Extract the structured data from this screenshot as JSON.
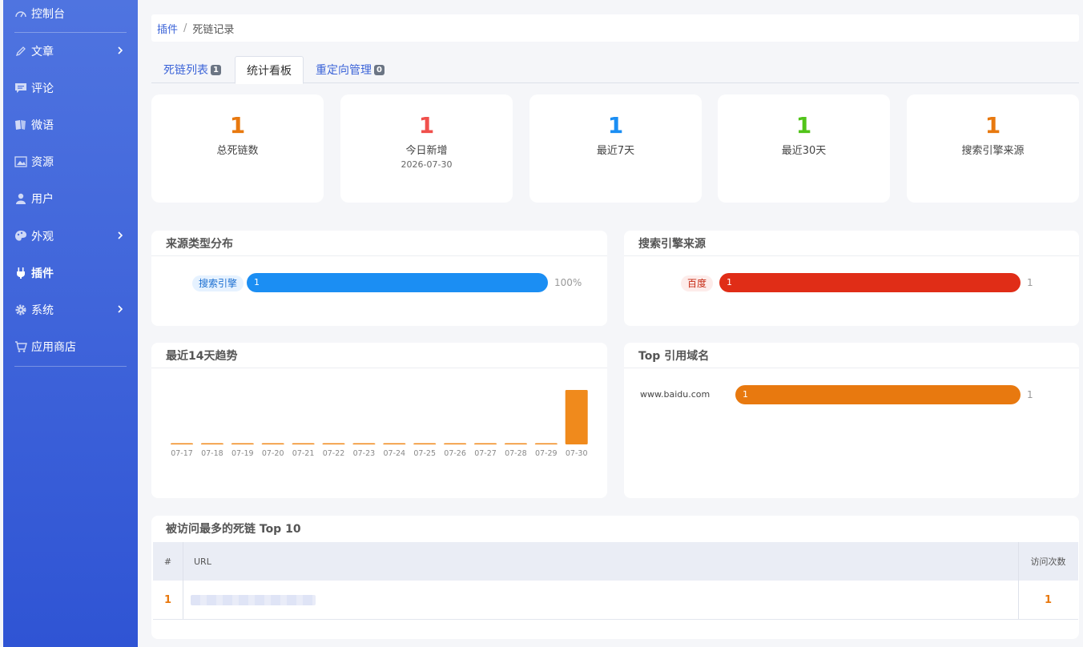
{
  "sidebar": {
    "items": [
      {
        "label": "控制台",
        "icon": "dashboard-icon",
        "has_children": false
      },
      {
        "label": "文章",
        "icon": "pencil-icon",
        "has_children": true
      },
      {
        "label": "评论",
        "icon": "comment-icon",
        "has_children": false
      },
      {
        "label": "微语",
        "icon": "cards-icon",
        "has_children": false
      },
      {
        "label": "资源",
        "icon": "image-icon",
        "has_children": false
      },
      {
        "label": "用户",
        "icon": "user-icon",
        "has_children": false
      },
      {
        "label": "外观",
        "icon": "palette-icon",
        "has_children": true
      },
      {
        "label": "插件",
        "icon": "plug-icon",
        "has_children": false,
        "active": true
      },
      {
        "label": "系统",
        "icon": "gear-icon",
        "has_children": true
      },
      {
        "label": "应用商店",
        "icon": "cart-icon",
        "has_children": false
      }
    ]
  },
  "breadcrumb": {
    "parent": "插件",
    "separator": "/",
    "current": "死链记录"
  },
  "tabs": [
    {
      "label": "死链列表",
      "count": "1"
    },
    {
      "label": "统计看板",
      "active": true
    },
    {
      "label": "重定向管理",
      "count": "0"
    }
  ],
  "stats": [
    {
      "value": "1",
      "label": "总死链数",
      "color": "#e8790f"
    },
    {
      "value": "1",
      "label": "今日新增",
      "sub": "2026-07-30",
      "color": "#f0504c"
    },
    {
      "value": "1",
      "label": "最近7天",
      "color": "#1b8ef3"
    },
    {
      "value": "1",
      "label": "最近30天",
      "color": "#52c41a"
    },
    {
      "value": "1",
      "label": "搜索引擎来源",
      "color": "#e8790f"
    }
  ],
  "source_panel": {
    "title": "来源类型分布",
    "rows": [
      {
        "tag": "搜索引擎",
        "value": "1",
        "percent_label": "100%",
        "fraction": 1.0,
        "color": "#1b8ef3"
      }
    ]
  },
  "engine_panel": {
    "title": "搜索引擎来源",
    "rows": [
      {
        "tag": "百度",
        "value": "1",
        "count_label": "1",
        "fraction": 1.0,
        "color": "#e02d17"
      }
    ]
  },
  "trend_panel": {
    "title": "最近14天趋势"
  },
  "domain_panel": {
    "title": "Top 引用域名",
    "rows": [
      {
        "domain": "www.baidu.com",
        "value": "1",
        "count_label": "1",
        "fraction": 1.0,
        "color": "#e8790f"
      }
    ]
  },
  "top_panel": {
    "title": "被访问最多的死链 Top 10",
    "columns": [
      "#",
      "URL",
      "访问次数"
    ],
    "rows": [
      {
        "rank": "1",
        "url": "",
        "visits": "1"
      }
    ]
  },
  "chart_data": {
    "type": "bar",
    "categories": [
      "07-17",
      "07-18",
      "07-19",
      "07-20",
      "07-21",
      "07-22",
      "07-23",
      "07-24",
      "07-25",
      "07-26",
      "07-27",
      "07-28",
      "07-29",
      "07-30"
    ],
    "values": [
      0,
      0,
      0,
      0,
      0,
      0,
      0,
      0,
      0,
      0,
      0,
      0,
      0,
      1
    ],
    "title": "最近14天趋势",
    "xlabel": "",
    "ylabel": "",
    "ylim": [
      0,
      1
    ],
    "color": "#f08a1c"
  }
}
